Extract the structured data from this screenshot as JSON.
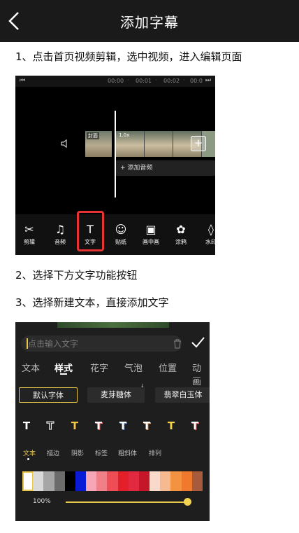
{
  "header": {
    "title": "添加字幕",
    "back_icon": "chevron-left-icon"
  },
  "steps": {
    "step1": "1、点击首页视频剪辑，选中视频，进入编辑页面",
    "step2": "2、选择下方文字功能按钮",
    "step3": "3、选择新建文本，直接添加文字"
  },
  "editor_screenshot": {
    "timeline_times": [
      "00:00",
      "00:01",
      "00:02",
      "00:0"
    ],
    "cover_label": "封面",
    "speed_label": "1.0x",
    "add_audio_label": "+ 添加音频",
    "tools": [
      {
        "label": "剪辑",
        "icon": "scissors-icon",
        "glyph": "✂"
      },
      {
        "label": "音频",
        "icon": "music-note-icon",
        "glyph": "♫"
      },
      {
        "label": "文字",
        "icon": "text-icon",
        "glyph": "T"
      },
      {
        "label": "贴纸",
        "icon": "sticker-face-icon",
        "glyph": "☺"
      },
      {
        "label": "画中画",
        "icon": "picture-in-picture-icon",
        "glyph": "▣"
      },
      {
        "label": "涂鸦",
        "icon": "doodle-icon",
        "glyph": "✿"
      },
      {
        "label": "水印",
        "icon": "watermark-drop-icon",
        "glyph": "◊"
      }
    ],
    "highlight_color": "#e53333"
  },
  "text_panel_screenshot": {
    "input_placeholder": "点击输入文字",
    "tabs": [
      "文本",
      "样式",
      "花字",
      "气泡",
      "位置",
      "动画"
    ],
    "active_tab": "样式",
    "fonts": [
      {
        "label": "默认字体",
        "selected": true
      },
      {
        "label": "麦芽糖体",
        "selected": false
      },
      {
        "label": "翡翠白玉体",
        "selected": false
      }
    ],
    "style_glyph": "T",
    "style_colors": [
      "#ffffff",
      "#ffffff",
      "#f2c744",
      "#e85a5a",
      "#ffffff",
      "#e88a3c",
      "#f2d34c",
      "#e85a5a"
    ],
    "sub_tabs": [
      "文本",
      "描边",
      "阴影",
      "标签",
      "粗斜体",
      "排列"
    ],
    "active_sub_tab": "文本",
    "swatch_colors": [
      "#ffffff",
      "#d9d9d9",
      "#a6a6a6",
      "#6b6b6b",
      "#000000",
      "#0a1bd6",
      "#f7a6b8",
      "#f07f87",
      "#ef4d55",
      "#e3202a",
      "#e12a3f",
      "#c4182a",
      "#f9d9c9",
      "#f7b98f",
      "#f39342",
      "#ef7a2e",
      "#a85a3c"
    ],
    "opacity": "100%",
    "opacity_value": 1.0,
    "accent_color": "#e8c84a"
  }
}
